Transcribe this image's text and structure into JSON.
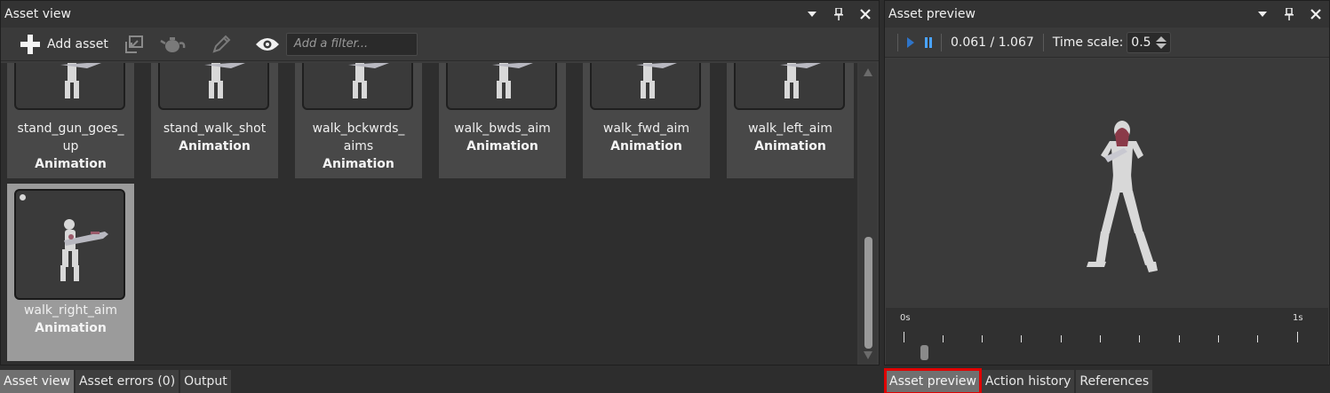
{
  "asset_view": {
    "title": "Asset view",
    "toolbar": {
      "add_label": "Add asset",
      "filter_placeholder": "Add a filter...",
      "icons": [
        "plus-icon",
        "import-icon",
        "teapot-icon",
        "pencil-icon",
        "eye-icon"
      ]
    },
    "assets": [
      {
        "name": "stand_gun_goes_up",
        "name_lines": [
          "stand_gun_goes_",
          "up"
        ],
        "type": "Animation"
      },
      {
        "name": "stand_walk_shot",
        "name_lines": [
          "stand_walk_shot"
        ],
        "type": "Animation"
      },
      {
        "name": "walk_bckwrds_aims",
        "name_lines": [
          "walk_bckwrds_",
          "aims"
        ],
        "type": "Animation"
      },
      {
        "name": "walk_bwds_aim",
        "name_lines": [
          "walk_bwds_aim"
        ],
        "type": "Animation"
      },
      {
        "name": "walk_fwd_aim",
        "name_lines": [
          "walk_fwd_aim"
        ],
        "type": "Animation"
      },
      {
        "name": "walk_left_aim",
        "name_lines": [
          "walk_left_aim"
        ],
        "type": "Animation"
      },
      {
        "name": "walk_right_aim",
        "name_lines": [
          "walk_right_aim"
        ],
        "type": "Animation",
        "selected": true
      }
    ],
    "tabs": [
      {
        "label": "Asset view",
        "active": true
      },
      {
        "label": "Asset errors (0)",
        "active": false
      },
      {
        "label": "Output",
        "active": false
      }
    ]
  },
  "asset_preview": {
    "title": "Asset preview",
    "playback": {
      "time": "0.061 / 1.067",
      "time_scale_label": "Time scale:",
      "time_scale_value": "0.5"
    },
    "timeline": {
      "start_label": "0s",
      "end_label": "1s"
    },
    "tabs": [
      {
        "label": "Asset preview",
        "active": true,
        "highlighted": true
      },
      {
        "label": "Action history",
        "active": false
      },
      {
        "label": "References",
        "active": false
      }
    ]
  },
  "colors": {
    "accent_blue": "#4aa3ff",
    "highlight_red": "#e00000",
    "selected_card": "#9b9b9b"
  }
}
